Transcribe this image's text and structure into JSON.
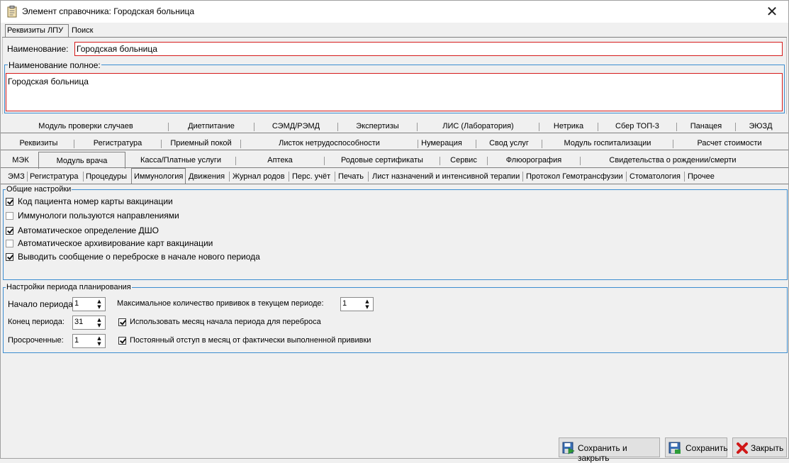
{
  "window": {
    "title": "Элемент справочника: Городская больница",
    "close_glyph": "✕"
  },
  "top_tabs": [
    "Реквизиты ЛПУ",
    "Поиск"
  ],
  "form": {
    "name_label": "Наименование:",
    "name_value": "Городская больница",
    "fullname_label": "Наименование полное:",
    "fullname_value": "Городская больница"
  },
  "tab_rows": {
    "row1": [
      "Модуль проверки случаев",
      "Диетпитание",
      "СЭМД/РЭМД",
      "Экспертизы",
      "ЛИС (Лаборатория)",
      "Нетрика",
      "Сбер ТОП-3",
      "Панацея",
      "ЭЮЗД"
    ],
    "row2": [
      "Реквизиты",
      "Регистратура",
      "Приемный покой",
      "Листок нетрудоспособности",
      "Нумерация",
      "Свод услуг",
      "Модуль госпитализации",
      "Расчет стоимости"
    ],
    "row3": [
      "МЭК",
      "Модуль врача",
      "Касса/Платные услуги",
      "Аптека",
      "Родовые сертификаты",
      "Сервис",
      "Флюорография",
      "Свидетельства о рождении/смерти"
    ]
  },
  "sub_tabs": [
    "ЭМЗ",
    "Регистратура",
    "Процедуры",
    "Иммунология",
    "Движения",
    "Журнал родов",
    "Перс. учёт",
    "Печать",
    "Лист назначений и интенсивной терапии",
    "Протокол Гемотрансфузии",
    "Стоматология",
    "Прочее"
  ],
  "general": {
    "title": "Общие настройки",
    "options": [
      {
        "label": "Код пациента номер карты вакцинации",
        "checked": true
      },
      {
        "label": "Иммунологи пользуются направлениями",
        "checked": false
      },
      {
        "label": "Автоматическое определение ДШО",
        "checked": true
      },
      {
        "label": "Автоматическое архивирование карт вакцинации",
        "checked": false
      },
      {
        "label": "Выводить сообщение о переброске в начале нового периода",
        "checked": true
      }
    ]
  },
  "period": {
    "title": "Настройки периода планирования",
    "start_label": "Начало периода",
    "start_value": "1",
    "end_label": "Конец периода:",
    "end_value": "31",
    "overdue_label": "Просроченные:",
    "overdue_value": "1",
    "max_label": "Максимальное количество прививок в текущем периоде:",
    "max_value": "1",
    "use_month_label": "Использовать месяц начала периода для переброса",
    "use_month_checked": true,
    "const_offset_label": "Постоянный отступ в месяц от фактически выполненной прививки",
    "const_offset_checked": true
  },
  "buttons": {
    "save_close": "Сохранить и закрыть",
    "save": "Сохранить",
    "close": "Закрыть"
  },
  "colors": {
    "accent_border": "#3c8dd0",
    "required_border": "#d61b1b"
  }
}
